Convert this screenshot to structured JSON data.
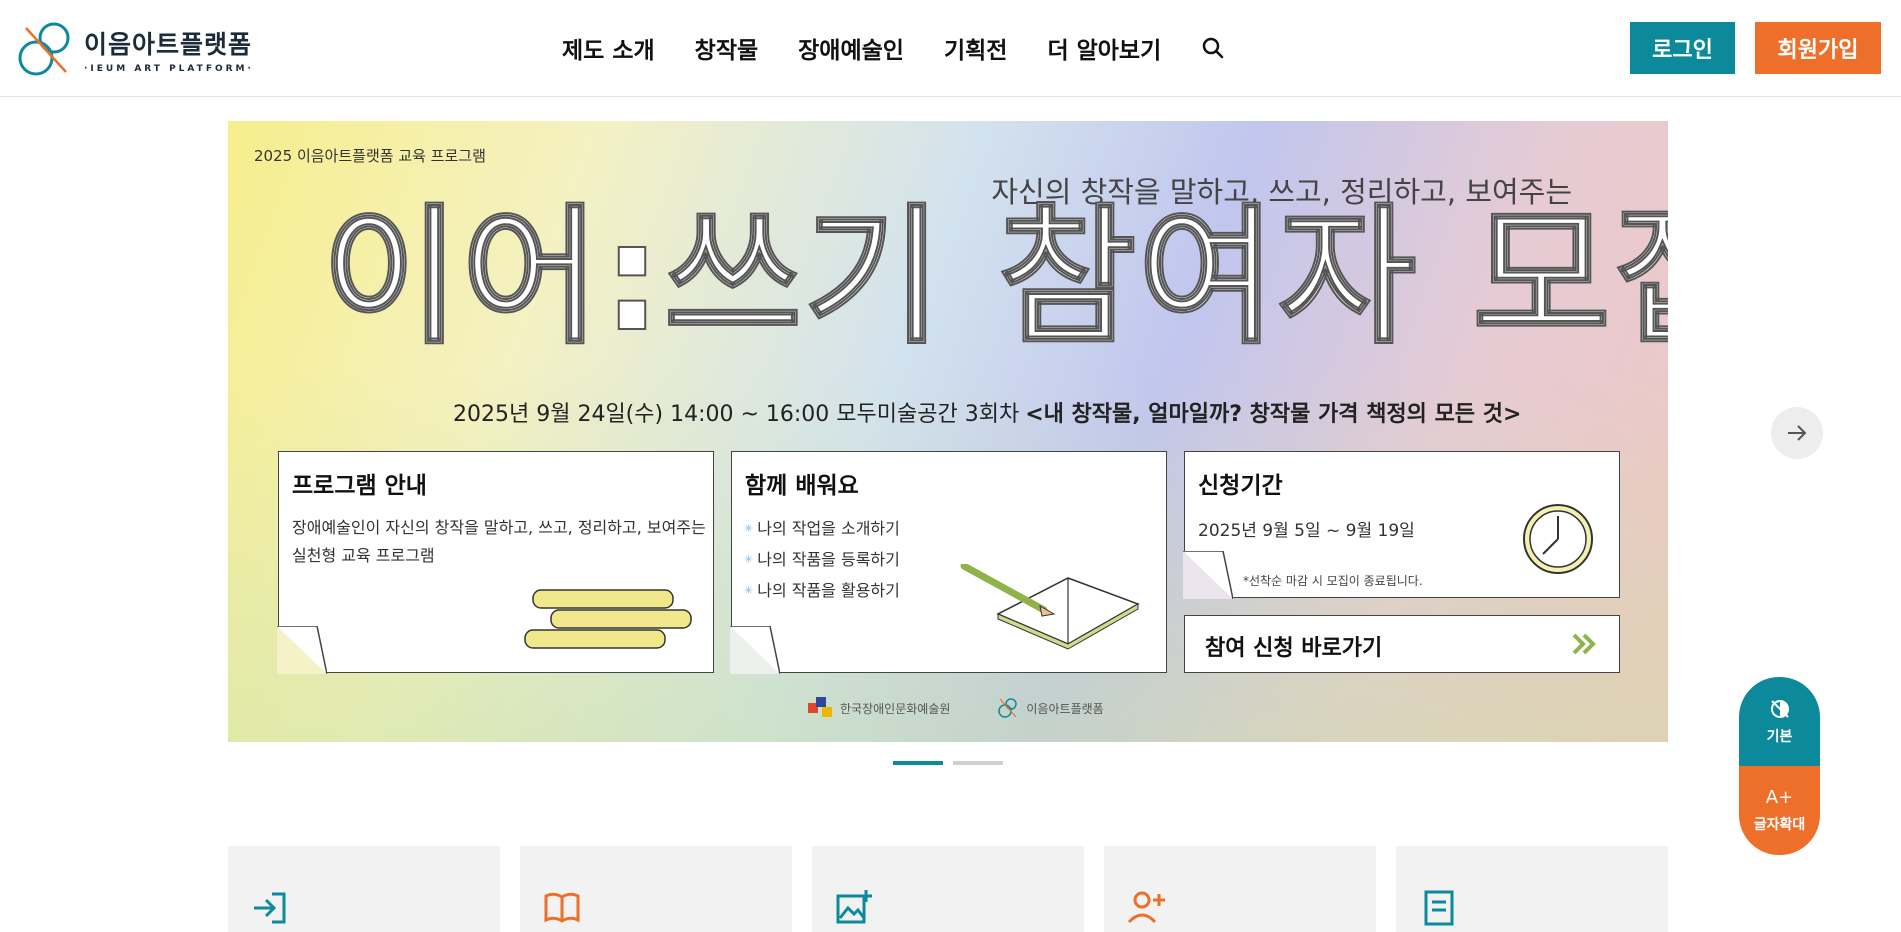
{
  "header": {
    "logo_name": "이음아트플랫폼",
    "logo_sub": "·IEUM ART PLATFORM·",
    "nav": [
      "제도 소개",
      "창작물",
      "장애예술인",
      "기획전",
      "더 알아보기"
    ],
    "search_icon": "search-icon",
    "login_label": "로그인",
    "join_label": "회원가입",
    "colors": {
      "teal": "#0c8a9c",
      "orange": "#ee6f2a"
    }
  },
  "banner": {
    "kicker": "2025 이음아트플랫폼 교육 프로그램",
    "subtitle": "자신의 창작을 말하고, 쓰고, 정리하고, 보여주는",
    "title": "이어:쓰기 참여자 모집",
    "event_date": "2025년 9월 24일(수) 14:00 ~ 16:00 모두미술공간 3회차",
    "event_topic": "<내 창작물, 얼마일까? 창작물 가격 책정의 모든 것>",
    "card_program": {
      "title": "프로그램 안내",
      "text": "장애예술인이 자신의 창작을 말하고, 쓰고, 정리하고, 보여주는 실천형 교육 프로그램"
    },
    "card_learn": {
      "title": "함께 배워요",
      "items": [
        "나의 작업을 소개하기",
        "나의 작품을 등록하기",
        "나의 작품을 활용하기"
      ]
    },
    "card_period": {
      "title": "신청기간",
      "dates": "2025년 9월 5일 ~ 9월 19일",
      "note": "*선착순 마감 시 모집이 종료됩니다."
    },
    "apply_label": "참여 신청 바로가기",
    "org1": "한국장애인문화예술원",
    "org2": "이음아트플랫폼"
  },
  "slider": {
    "active_index": 0,
    "count": 2,
    "next_icon": "arrow-right-icon"
  },
  "accessibility": {
    "default_label": "기본",
    "zoom_label": "글자확대",
    "zoom_icon_text": "A+"
  },
  "quick_menu": [
    "login-icon",
    "book-icon",
    "image-plus-icon",
    "user-plus-icon",
    "document-icon"
  ]
}
